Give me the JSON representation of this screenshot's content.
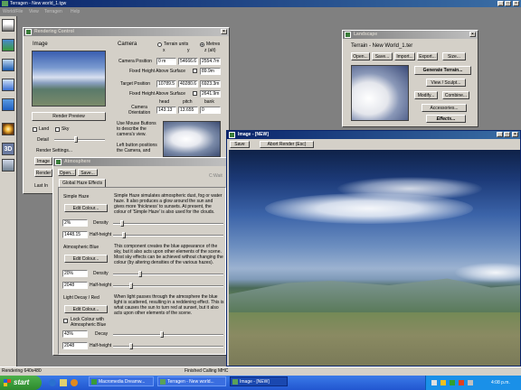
{
  "app": {
    "title": "Terragen - New world_1.tgw",
    "menu": [
      "World/File",
      "View",
      "Terragen",
      "Help"
    ],
    "status_left": "Rendering 640x480",
    "status_right": "Finished Calling MHC"
  },
  "toolbar": {
    "icons": [
      "landscape-icon",
      "terrain-icon",
      "water-icon",
      "sky-icon",
      "atmosphere-icon",
      "lighting-icon",
      "3d-icon",
      "camera-icon"
    ],
    "label_3d": "3D"
  },
  "render": {
    "title": "Rendering Control",
    "image_label": "Image",
    "render_preview": "Render Preview",
    "land": "Land",
    "sky": "Sky",
    "detail": "Detail",
    "render_settings": "Render Settings...",
    "image_btn": "Image",
    "render_btn": "Render",
    "last_label": "Last In",
    "camera_label": "Camera",
    "terrain_units": "Terrain units",
    "metres": "Metres",
    "col_x": "x",
    "col_y": "y",
    "col_z": "z (alt)",
    "camera_position": "Camera Position",
    "cam_x": "0 m",
    "cam_y": "54666.6",
    "cam_z": "2554.7m",
    "fixed_height": "Fixed Height Above Surface",
    "fixed_1": "89.9m",
    "target_position": "Target Position",
    "tgt_x": "10789.5",
    "tgt_y": "40280.6",
    "tgt_z": "6923.3m",
    "fixed_2": "2641.9m",
    "col_head": "head",
    "col_pitch": "pitch",
    "col_bank": "bank",
    "camera_orientation": "Camera Orientation",
    "head": "143.13",
    "pitch": "13.655",
    "bank": "0",
    "mouse_hint": "Use Mouse Buttons to describe the camera's view.",
    "left_hint": "Left button positions the Camera, and"
  },
  "landscape": {
    "title": "Landscape",
    "terrain_name": "Terrain - New World_1.ter",
    "open": "Open...",
    "save": "Save...",
    "import": "Import...",
    "export": "Export...",
    "size": "Size...",
    "generate": "Generate Terrain...",
    "view_sculpt": "View / Sculpt...",
    "modify": "Modify...",
    "combine": "Combine...",
    "accessories": "Accessories...",
    "effects": "Effects..."
  },
  "atmosphere": {
    "title": "Atmosphere",
    "open": "Open...",
    "save": "Save...",
    "tab": "Global Haze Effects",
    "cwait": "C:Wait",
    "haze": {
      "label": "Simple Haze",
      "edit": "Edit Colour...",
      "density_val": "2%",
      "density": "Density",
      "half_val": "1448.15",
      "half": "Half-height",
      "desc": "Simple Haze simulates atmospheric dust, fog or water haze. It also produces a glow around the sun and gives more 'thickness' to sunsets. At present, the colour of 'Simple Haze' is also used for the clouds."
    },
    "blue": {
      "label": "Atmospheric Blue",
      "edit": "Edit Colour...",
      "density_val": "20%",
      "density": "Density",
      "half_val": "2048",
      "half": "Half-height",
      "desc": "This component creates the blue appearance of the sky, but it also acts upon other elements of the scene. Most sky effects can be achieved without changing the colour (by altering densities of the various hazes)."
    },
    "decay": {
      "label": "Light Decay / Red",
      "edit": "Edit Colour...",
      "lock": "Lock Colour with Atmospheric Blue",
      "decay_val": "43%",
      "decay": "Decay",
      "half_val": "2048",
      "half": "Half-height",
      "desc": "When light passes through the atmosphere the blue light is scattered, resulting in a reddening effect. This is what causes the sun to turn red at sunset, but it also acts upon other elements of the scene."
    }
  },
  "imagewin": {
    "title": "Image - [NEW]",
    "save": "Save",
    "abort": "Abort Render (Esc)"
  },
  "taskbar": {
    "start": "start",
    "items": [
      "Macromedia Dreamw...",
      "Terragen - New world...",
      "Image - [NEW]"
    ],
    "clock": "4:08 p.m."
  }
}
